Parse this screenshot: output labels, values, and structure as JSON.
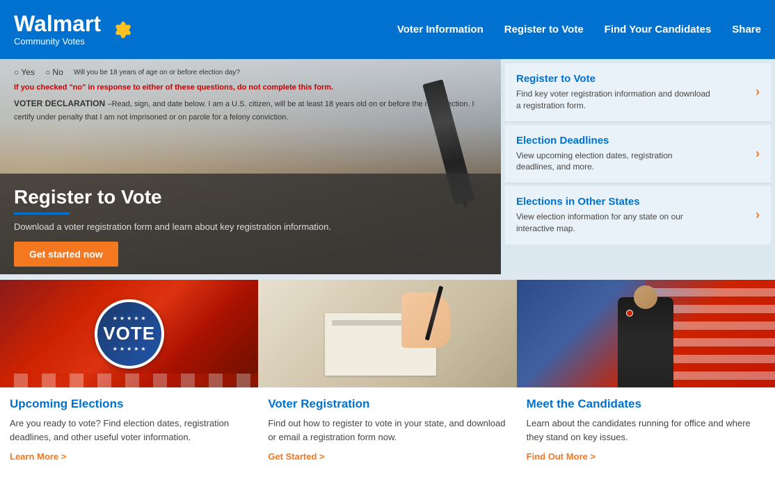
{
  "header": {
    "brand": "Walmart",
    "subtitle": "Community Votes",
    "nav": [
      {
        "label": "Voter Information",
        "id": "voter-information"
      },
      {
        "label": "Register to Vote",
        "id": "register-to-vote"
      },
      {
        "label": "Find Your Candidates",
        "id": "find-candidates"
      },
      {
        "label": "Share",
        "id": "share"
      }
    ]
  },
  "hero": {
    "form_line1": "Will you be 18 years of age on or before election day?",
    "form_yes": "Yes",
    "form_no": "No",
    "form_red_text": "If you checked \"no\" in response to either of these questions, do not complete this form.",
    "form_declaration": "VOTER DECLARATION",
    "form_body": "–Read, sign, and date below. I am a U.S. citizen, will be at least 18 years old on or before the next election. I certify under penalty that I am not imprisoned or on parole for a felony conviction.",
    "title": "Register to Vote",
    "description": "Download a voter registration form and learn about key registration information.",
    "cta_button": "Get started now"
  },
  "sidebar": {
    "panels": [
      {
        "title": "Register to Vote",
        "description": "Find key voter registration information and download a registration form."
      },
      {
        "title": "Election Deadlines",
        "description": "View upcoming election dates, registration deadlines, and more."
      },
      {
        "title": "Elections in Other States",
        "description": "View election information for any state on our interactive map."
      }
    ]
  },
  "cards": [
    {
      "title": "Upcoming Elections",
      "description": "Are you ready to vote? Find election dates, registration deadlines, and other useful voter information.",
      "link": "Learn More"
    },
    {
      "title": "Voter Registration",
      "description": "Find out how to register to vote in your state, and download or email a registration form now.",
      "link": "Get Started"
    },
    {
      "title": "Meet the Candidates",
      "description": "Learn about the candidates running for office and where they stand on key issues.",
      "link": "Find Out More"
    }
  ],
  "colors": {
    "walmart_blue": "#0071ce",
    "orange": "#f47820",
    "dark_text": "#444"
  }
}
